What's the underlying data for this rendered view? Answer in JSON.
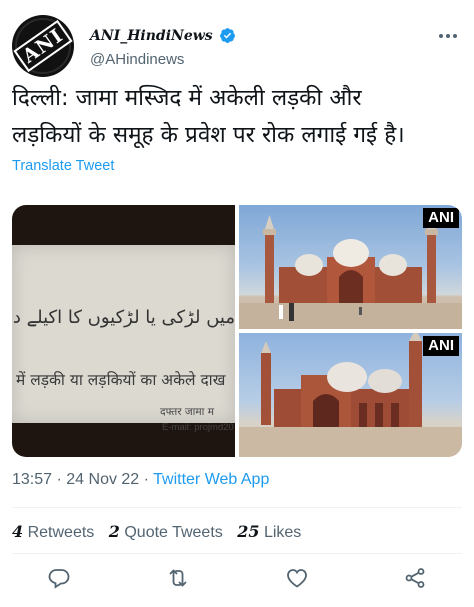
{
  "header": {
    "display_name": "ANI_HindiNews",
    "handle": "@AHindinews",
    "avatar_text": "ANI"
  },
  "tweet": {
    "text_line1": "दिल्ली: जामा मस्जिद में अकेली लड़की और",
    "text_line2": "लड़कियों के समूह के प्रवेश पर रोक लगाई गई है।",
    "translate_label": "Translate Tweet"
  },
  "media": {
    "sign_urdu": "میں لڑکی یا لڑکیوں کا اکیلے داخ",
    "sign_hindi": "में लड़की या लड़कियों का अकेले दाख",
    "sign_office": "दफ्तर जामा म",
    "sign_email": "E-mail: projmd20",
    "badge_top": "ANI",
    "badge_bottom": "ANI"
  },
  "meta": {
    "time": "13:57",
    "separator1": " · ",
    "date": "24 Nov 22",
    "separator2": " · ",
    "app": "Twitter Web App"
  },
  "stats": {
    "retweets_count": "4",
    "retweets_label": "Retweets",
    "quotes_count": "2",
    "quotes_label": "Quote Tweets",
    "likes_count": "25",
    "likes_label": "Likes"
  },
  "colors": {
    "accent": "#1d9bf0",
    "secondary_text": "#536471",
    "divider": "#eff3f4"
  }
}
